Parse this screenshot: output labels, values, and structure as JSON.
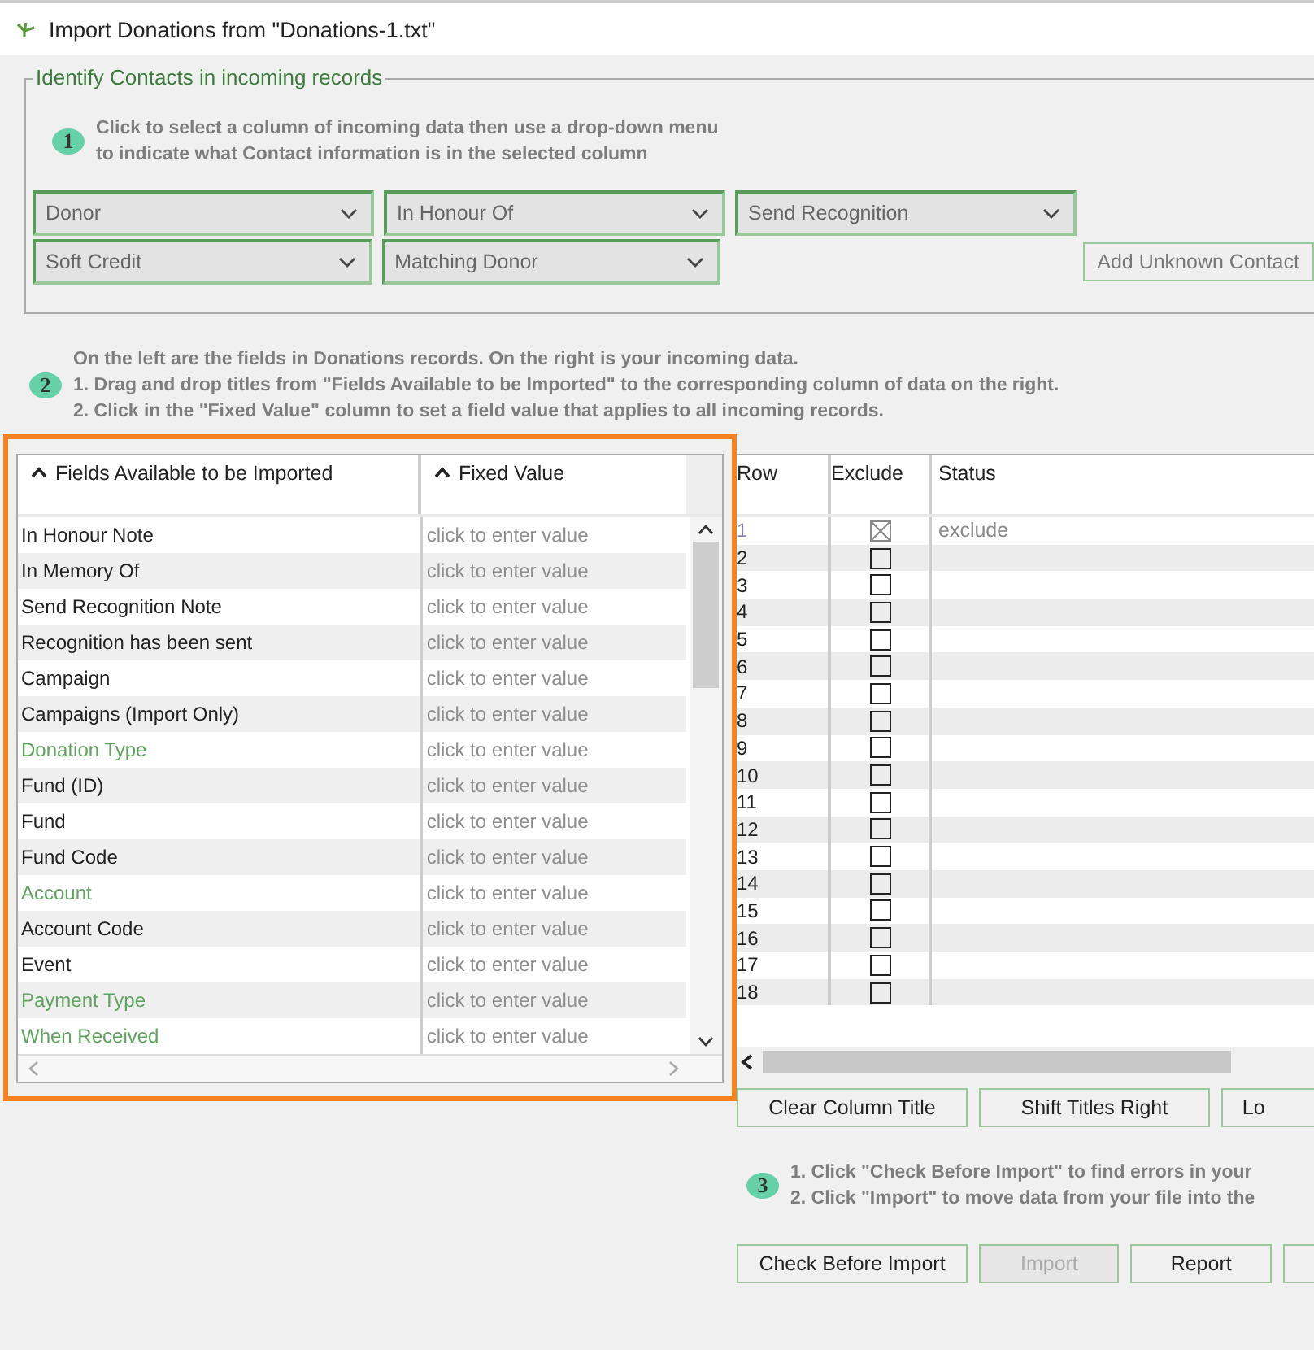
{
  "window": {
    "title": "Import Donations from \"Donations-1.txt\""
  },
  "contacts_group": {
    "legend": "Identify Contacts in incoming records",
    "step": "1",
    "instructions": [
      "Click to select a column of incoming data then use a drop-down menu",
      "to indicate what Contact information is in the selected column"
    ],
    "dropdown_rows": [
      [
        {
          "value": "Donor"
        },
        {
          "value": "In Honour Of"
        },
        {
          "value": "Send Recognition"
        }
      ],
      [
        {
          "value": "Soft Credit"
        },
        {
          "value": "Matching Donor"
        }
      ]
    ],
    "add_button": "Add Unknown Contact"
  },
  "step2": {
    "step": "2",
    "instructions": [
      "On the left are the fields in Donations records. On the right is your incoming data.",
      "1. Drag and drop titles from \"Fields Available to be Imported\" to the corresponding column of data on the right.",
      "2. Click in the \"Fixed Value\" column to set a field value that applies to all incoming records."
    ]
  },
  "fields_table": {
    "highlighted": true,
    "columns": [
      "Fields Available to be Imported",
      "Fixed Value"
    ],
    "rows": [
      {
        "field": "In Honour Note",
        "green": false,
        "placeholder": "click to enter value"
      },
      {
        "field": "In Memory Of",
        "green": false,
        "placeholder": "click to enter value"
      },
      {
        "field": "Send Recognition Note",
        "green": false,
        "placeholder": "click to enter value"
      },
      {
        "field": "Recognition has been sent",
        "green": false,
        "placeholder": "click to enter value"
      },
      {
        "field": "Campaign",
        "green": false,
        "placeholder": "click to enter value"
      },
      {
        "field": "Campaigns (Import Only)",
        "green": false,
        "placeholder": "click to enter value"
      },
      {
        "field": "Donation Type",
        "green": true,
        "placeholder": "click to enter value"
      },
      {
        "field": "Fund (ID)",
        "green": false,
        "placeholder": "click to enter value"
      },
      {
        "field": "Fund",
        "green": false,
        "placeholder": "click to enter value"
      },
      {
        "field": "Fund Code",
        "green": false,
        "placeholder": "click to enter value"
      },
      {
        "field": "Account",
        "green": true,
        "placeholder": "click to enter value"
      },
      {
        "field": "Account Code",
        "green": false,
        "placeholder": "click to enter value"
      },
      {
        "field": "Event",
        "green": false,
        "placeholder": "click to enter value"
      },
      {
        "field": "Payment Type",
        "green": true,
        "placeholder": "click to enter value"
      },
      {
        "field": "When Received",
        "green": true,
        "placeholder": "click to enter value"
      }
    ]
  },
  "data_table": {
    "columns": [
      "Row",
      "Exclude",
      "Status"
    ],
    "rows": [
      {
        "row": "1",
        "excluded": true,
        "status": "exclude"
      },
      {
        "row": "2",
        "excluded": false
      },
      {
        "row": "3",
        "excluded": false
      },
      {
        "row": "4",
        "excluded": false
      },
      {
        "row": "5",
        "excluded": false
      },
      {
        "row": "6",
        "excluded": false
      },
      {
        "row": "7",
        "excluded": false
      },
      {
        "row": "8",
        "excluded": false
      },
      {
        "row": "9",
        "excluded": false
      },
      {
        "row": "10",
        "excluded": false
      },
      {
        "row": "11",
        "excluded": false
      },
      {
        "row": "12",
        "excluded": false
      },
      {
        "row": "13",
        "excluded": false
      },
      {
        "row": "14",
        "excluded": false
      },
      {
        "row": "15",
        "excluded": false
      },
      {
        "row": "16",
        "excluded": false
      },
      {
        "row": "17",
        "excluded": false
      },
      {
        "row": "18",
        "excluded": false
      }
    ]
  },
  "column_buttons": [
    {
      "label": "Clear Column Title",
      "disabled": false
    },
    {
      "label": "Shift Titles Right",
      "disabled": false
    },
    {
      "label": "Lo",
      "disabled": false
    }
  ],
  "step3": {
    "step": "3",
    "instructions": [
      "1. Click \"Check Before Import\" to find errors in your",
      "2. Click \"Import\" to move data from your file into the"
    ]
  },
  "action_buttons": [
    {
      "label": "Check Before Import",
      "disabled": false
    },
    {
      "label": "Import",
      "disabled": true
    },
    {
      "label": "Report",
      "disabled": false
    }
  ]
}
